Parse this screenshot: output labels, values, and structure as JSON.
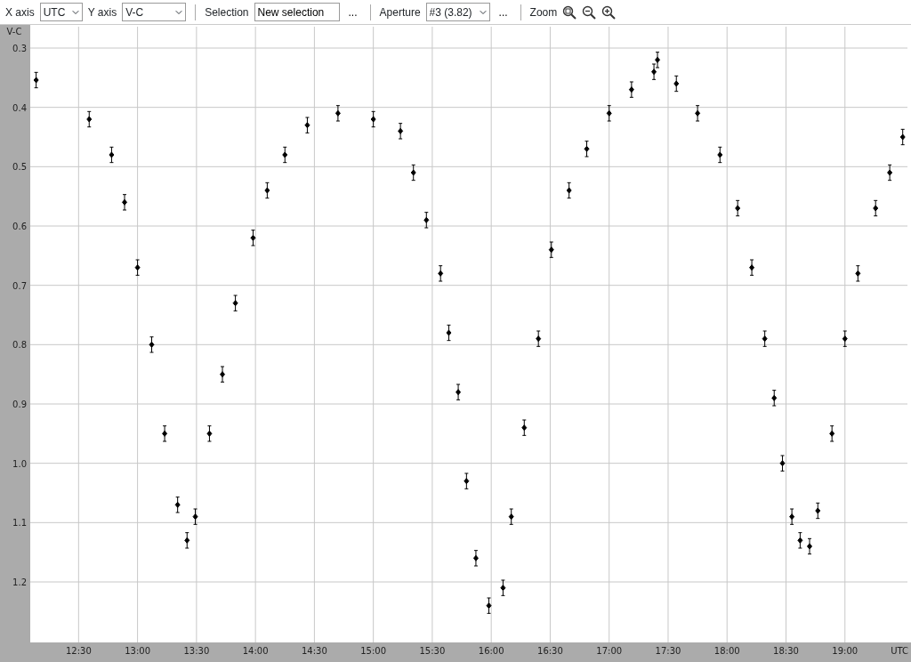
{
  "toolbar": {
    "x_axis": {
      "label": "X axis",
      "value": "UTC"
    },
    "y_axis": {
      "label": "Y axis",
      "value": "V-C"
    },
    "selection": {
      "label": "Selection",
      "value": "New selection",
      "more": "..."
    },
    "aperture": {
      "label": "Aperture",
      "value": "#3 (3.82)",
      "more": "..."
    },
    "zoom": {
      "label": "Zoom"
    }
  },
  "chart_data": {
    "type": "scatter",
    "xlabel": "UTC",
    "ylabel": "V-C",
    "xlim": [
      12.09,
      19.53
    ],
    "ylim": [
      1.302,
      0.264
    ],
    "xticks": [
      {
        "value": 12.5,
        "label": "12:30"
      },
      {
        "value": 13,
        "label": "13:00"
      },
      {
        "value": 13.5,
        "label": "13:30"
      },
      {
        "value": 14,
        "label": "14:00"
      },
      {
        "value": 14.5,
        "label": "14:30"
      },
      {
        "value": 15,
        "label": "15:00"
      },
      {
        "value": 15.5,
        "label": "15:30"
      },
      {
        "value": 16,
        "label": "16:00"
      },
      {
        "value": 16.5,
        "label": "16:30"
      },
      {
        "value": 17,
        "label": "17:00"
      },
      {
        "value": 17.5,
        "label": "17:30"
      },
      {
        "value": 18,
        "label": "18:00"
      },
      {
        "value": 18.5,
        "label": "18:30"
      },
      {
        "value": 19,
        "label": "19:00"
      }
    ],
    "yticks": [
      {
        "value": 0.3,
        "label": "0.3"
      },
      {
        "value": 0.4,
        "label": "0.4"
      },
      {
        "value": 0.5,
        "label": "0.5"
      },
      {
        "value": 0.6,
        "label": "0.6"
      },
      {
        "value": 0.7,
        "label": "0.7"
      },
      {
        "value": 0.8,
        "label": "0.8"
      },
      {
        "value": 0.9,
        "label": "0.9"
      },
      {
        "value": 1.0,
        "label": "1.0"
      },
      {
        "value": 1.1,
        "label": "1.1"
      },
      {
        "value": 1.2,
        "label": "1.2"
      }
    ],
    "x": [
      12.14,
      12.59,
      12.78,
      12.89,
      13.0,
      13.12,
      13.23,
      13.34,
      13.42,
      13.49,
      13.61,
      13.72,
      13.83,
      13.98,
      14.1,
      14.25,
      14.44,
      14.7,
      15.0,
      15.23,
      15.34,
      15.45,
      15.57,
      15.64,
      15.72,
      15.79,
      15.87,
      15.98,
      16.1,
      16.17,
      16.28,
      16.4,
      16.51,
      16.66,
      16.81,
      17.0,
      17.19,
      17.38,
      17.41,
      17.57,
      17.75,
      17.94,
      18.09,
      18.21,
      18.32,
      18.4,
      18.47,
      18.55,
      18.62,
      18.7,
      18.77,
      18.89,
      19.0,
      19.11,
      19.26,
      19.38,
      19.49
    ],
    "grid": true,
    "series": [
      {
        "color": "#000000",
        "errors": [
          0.013,
          0.013,
          0.013,
          0.013,
          0.013,
          0.013,
          0.013,
          0.013,
          0.013,
          0.013,
          0.013,
          0.013,
          0.013,
          0.013,
          0.013,
          0.013,
          0.013,
          0.013,
          0.013,
          0.013,
          0.013,
          0.013,
          0.013,
          0.013,
          0.013,
          0.013,
          0.013,
          0.013,
          0.013,
          0.013,
          0.013,
          0.013,
          0.013,
          0.013,
          0.013,
          0.013,
          0.013,
          0.013,
          0.013,
          0.013,
          0.013,
          0.013,
          0.013,
          0.013,
          0.013,
          0.013,
          0.013,
          0.013,
          0.013,
          0.013,
          0.013,
          0.013,
          0.013,
          0.013,
          0.013,
          0.013,
          0.013
        ],
        "values": [
          0.354,
          0.42,
          0.48,
          0.56,
          0.67,
          0.8,
          0.95,
          1.07,
          1.13,
          1.09,
          0.95,
          0.85,
          0.73,
          0.62,
          0.54,
          0.48,
          0.43,
          0.41,
          0.42,
          0.44,
          0.51,
          0.59,
          0.68,
          0.78,
          0.88,
          1.03,
          1.16,
          1.24,
          1.21,
          1.09,
          0.94,
          0.79,
          0.64,
          0.54,
          0.47,
          0.41,
          0.37,
          0.34,
          0.32,
          0.36,
          0.41,
          0.48,
          0.57,
          0.67,
          0.79,
          0.89,
          1.0,
          1.09,
          1.13,
          1.14,
          1.08,
          0.95,
          0.79,
          0.68,
          0.57,
          0.51,
          0.45
        ]
      }
    ]
  }
}
